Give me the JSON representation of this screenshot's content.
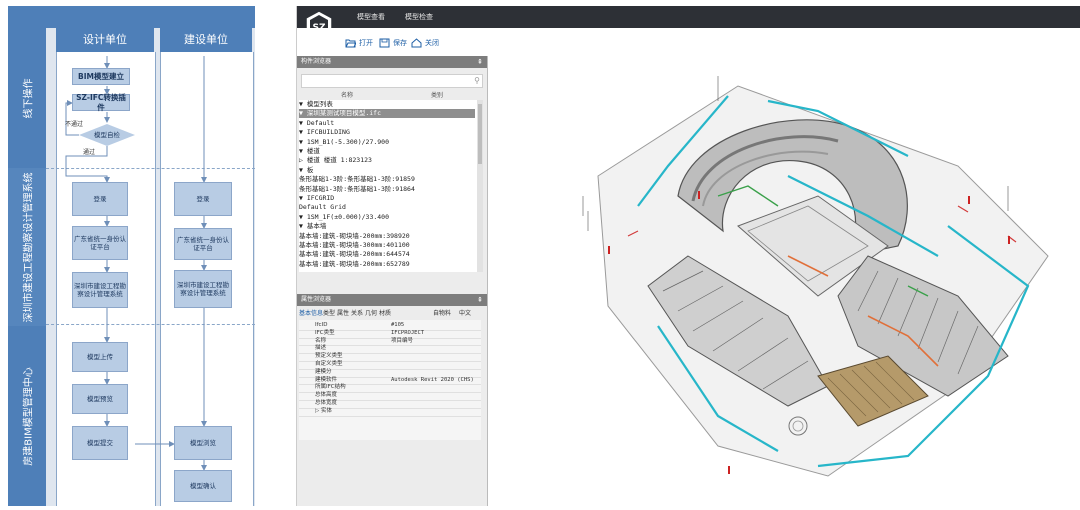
{
  "flowchart": {
    "lanes": [
      "设计单位",
      "建设单位"
    ],
    "phases": [
      "线下操作",
      "深圳市建设工程勘察设计管理系统",
      "房建BIM模型管理中心"
    ],
    "nodes": {
      "bim_build": "BIM模型建立",
      "ifc_plugin": "SZ-IFC转换插件",
      "self_check": "模型自检",
      "login_design": "登录",
      "gd_auth_design": "广东省统一身份认证平台",
      "sz_sys_design": "深圳市建设工程勘察设计管理系统",
      "model_upload": "模型上传",
      "model_check": "模型预览",
      "model_submit": "模型提交",
      "login_client": "登录",
      "gd_auth_client": "广东省统一身份认证平台",
      "sz_sys_client": "深圳市建设工程勘察设计管理系统",
      "model_review": "模型浏览",
      "model_confirm": "模型确认"
    },
    "labels": {
      "not_pass": "不通过",
      "pass": "通过"
    }
  },
  "app": {
    "menu": [
      "模型查看",
      "模型检查"
    ],
    "toolbar": {
      "open": "打开",
      "save": "保存",
      "close": "关闭"
    },
    "tree_panel": {
      "title": "构件浏览器",
      "col_name": "名称",
      "col_type": "类别",
      "rows": [
        "▼ 模型列表",
        "  ▼ 深圳某测试项目模型.ifc",
        "    ▼ Default",
        "      ▼ IFCBUILDING",
        "        ▼ 1SM_B1(-5.300)/27.900",
        "          ▼ 楼道",
        "            ▷ 楼道 楼道 1:823123",
        "          ▼ 板",
        "              条形基础1-3阶:条形基础1-3阶:91859",
        "              条形基础1-3阶:条形基础1-3阶:91864",
        "          ▼ IFCGRID",
        "              Default Grid",
        "        ▼ 1SM_1F(±0.000)/33.400",
        "          ▼ 基本墙",
        "              基本墙:建筑-砌块墙-200mm:398920",
        "              基本墙:建筑-砌块墙-300mm:401100",
        "              基本墙:建筑-砌块墙-200mm:644574",
        "              基本墙:建筑-砌块墙-200mm:652789"
      ]
    },
    "prop_panel": {
      "title": "属性浏览器",
      "tabs": [
        "基本信息",
        "类型",
        "属性",
        "关系",
        "几何",
        "材质"
      ],
      "right_tabs": [
        "自物料",
        "中文"
      ],
      "rows": [
        {
          "k": "IfcID",
          "v": "#105"
        },
        {
          "k": "IFC类型",
          "v": "IFCPROJECT"
        },
        {
          "k": "名称",
          "v": "项目编号"
        },
        {
          "k": "描述",
          "v": ""
        },
        {
          "k": "预定义类型",
          "v": ""
        },
        {
          "k": "自定义类型",
          "v": ""
        },
        {
          "k": "建模分",
          "v": ""
        },
        {
          "k": "建模软件",
          "v": "Autodesk Revit 2020 (CHS)"
        },
        {
          "k": "所属IFC结构",
          "v": ""
        },
        {
          "k": "总体高度",
          "v": ""
        },
        {
          "k": "总体宽度",
          "v": ""
        },
        {
          "k": "▷ 实体",
          "v": ""
        }
      ]
    }
  },
  "colors": {
    "lane_blue": "#4e7fb8",
    "box_blue": "#b8cce4",
    "titlebar": "#2d3036",
    "accent": "#1e5fa6"
  }
}
